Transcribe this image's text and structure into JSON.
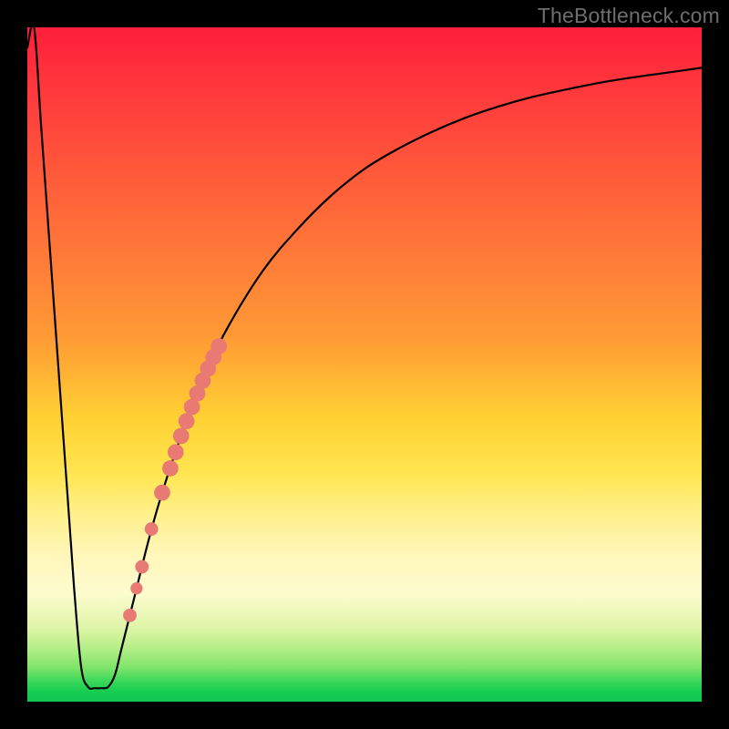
{
  "watermark": "TheBottleneck.com",
  "chart_data": {
    "type": "line",
    "title": "",
    "xlabel": "",
    "ylabel": "",
    "xlim": [
      0,
      100
    ],
    "ylim": [
      0,
      100
    ],
    "grid": false,
    "legend": false,
    "series": [
      {
        "name": "bottleneck-curve",
        "x": [
          0,
          1,
          2,
          3,
          4,
          5,
          6,
          7,
          8,
          9,
          10,
          11,
          12,
          13,
          14,
          16,
          18,
          20,
          23,
          26,
          30,
          35,
          40,
          45,
          50,
          55,
          60,
          65,
          70,
          75,
          80,
          85,
          90,
          95,
          100
        ],
        "values": [
          97,
          100,
          86,
          72,
          58,
          44,
          30,
          16,
          5,
          2.2,
          2.0,
          2.0,
          2.2,
          4,
          8,
          16,
          24,
          31,
          40,
          48,
          56,
          64,
          70,
          75,
          79,
          82,
          84.5,
          86.6,
          88.3,
          89.7,
          90.8,
          91.8,
          92.6,
          93.3,
          94
        ]
      }
    ],
    "markers": {
      "name": "highlight-dots",
      "color": "#e97a73",
      "points": [
        {
          "x": 20.0,
          "y": 31.0,
          "r": 1.2
        },
        {
          "x": 21.2,
          "y": 34.6,
          "r": 1.2
        },
        {
          "x": 22.0,
          "y": 37.0,
          "r": 1.2
        },
        {
          "x": 22.8,
          "y": 39.4,
          "r": 1.2
        },
        {
          "x": 23.6,
          "y": 41.6,
          "r": 1.2
        },
        {
          "x": 24.4,
          "y": 43.7,
          "r": 1.2
        },
        {
          "x": 25.2,
          "y": 45.7,
          "r": 1.2
        },
        {
          "x": 26.0,
          "y": 47.6,
          "r": 1.2
        },
        {
          "x": 26.8,
          "y": 49.4,
          "r": 1.2
        },
        {
          "x": 27.6,
          "y": 51.1,
          "r": 1.2
        },
        {
          "x": 28.4,
          "y": 52.7,
          "r": 1.2
        },
        {
          "x": 18.4,
          "y": 25.6,
          "r": 1.0
        },
        {
          "x": 17.0,
          "y": 20.0,
          "r": 1.0
        },
        {
          "x": 16.2,
          "y": 16.8,
          "r": 0.9
        },
        {
          "x": 15.2,
          "y": 12.8,
          "r": 1.0
        }
      ]
    },
    "background_gradient": {
      "top": "#ff1f3c",
      "mid": "#ffd233",
      "bottom": "#18cd53"
    }
  }
}
